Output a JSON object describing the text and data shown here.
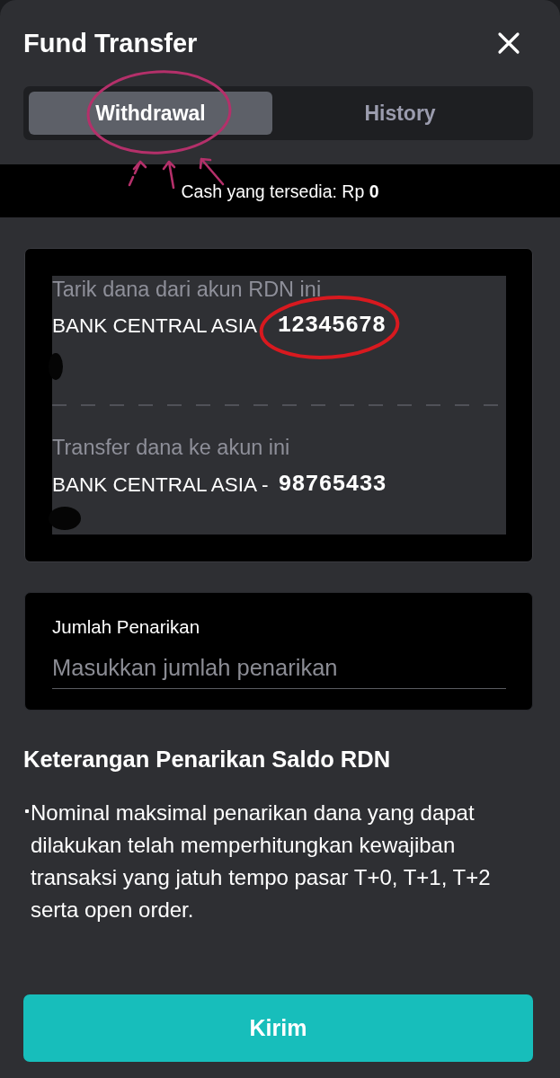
{
  "header": {
    "title": "Fund Transfer"
  },
  "tabs": [
    {
      "label": "Withdrawal",
      "selected": true,
      "circled": true
    },
    {
      "label": "History",
      "selected": false,
      "circled": false
    }
  ],
  "balance": {
    "text": "Cash yang tersedia: Rp **0**"
  },
  "accounts": [
    {
      "label": "Tarik dana dari akun RDN ini",
      "bank": "BANK CENTRAL ASIA",
      "number": "12345678",
      "circled": true
    },
    {
      "label": "Transfer dana ke akun ini",
      "bank": "BANK CENTRAL ASIA -",
      "number": "98765433",
      "circled": false
    }
  ],
  "amount_field": {
    "label": "Jumlah Penarikan",
    "placeholder": "Masukkan jumlah penarikan"
  },
  "notes": {
    "title": "Keterangan Penarikan Saldo RDN",
    "items": [
      "Nominal maksimal penarikan dana yang dapat dilakukan telah memperhitungkan kewajiban transaksi yang jatuh tempo pasar T+0, T+1, T+2 serta open order."
    ]
  },
  "submit_button": {
    "label": "Kirim"
  }
}
